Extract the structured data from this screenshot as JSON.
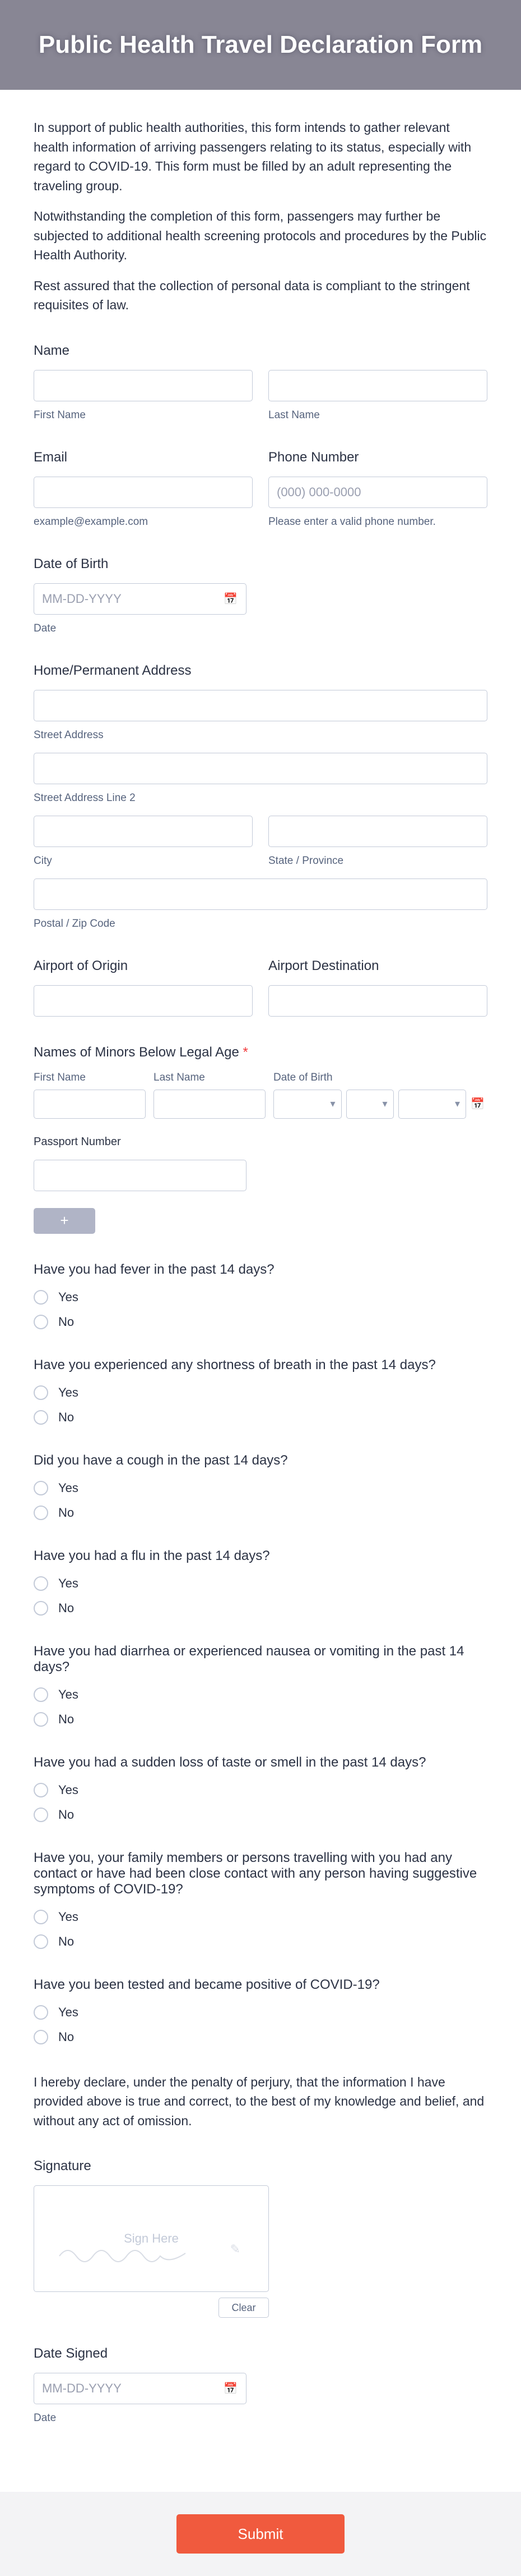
{
  "header": {
    "title": "Public Health Travel Declaration Form"
  },
  "intro": {
    "p1": "In support of public health authorities, this form intends to gather relevant health information of arriving passengers relating to its status, especially with regard to COVID-19. This form must be filled by an adult representing the traveling group.",
    "p2": "Notwithstanding the completion of this form, passengers may further be subjected to additional health screening protocols and procedures by the Public Health Authority.",
    "p3": "Rest assured that the collection of personal data is compliant to the stringent requisites of law."
  },
  "labels": {
    "name": "Name",
    "first_name_sub": "First Name",
    "last_name_sub": "Last Name",
    "email": "Email",
    "email_sub": "example@example.com",
    "phone": "Phone Number",
    "phone_placeholder": "(000) 000-0000",
    "phone_sub": "Please enter a valid phone number.",
    "dob": "Date of Birth",
    "date_placeholder": "MM-DD-YYYY",
    "date_sub": "Date",
    "address": "Home/Permanent Address",
    "street": "Street Address",
    "street2": "Street Address Line 2",
    "city": "City",
    "state": "State / Province",
    "postal": "Postal / Zip Code",
    "airport_origin": "Airport of Origin",
    "airport_dest": "Airport Destination",
    "minors": "Names of Minors Below Legal Age",
    "minors_fn": "First Name",
    "minors_ln": "Last Name",
    "minors_dob": "Date of Birth",
    "passport": "Passport Number",
    "add_plus": "+",
    "yes": "Yes",
    "no": "No",
    "signature": "Signature",
    "sign_here": "Sign Here",
    "clear": "Clear",
    "date_signed": "Date Signed",
    "submit": "Submit"
  },
  "questions": {
    "q1": "Have you had fever in the past 14 days?",
    "q2": "Have you experienced any shortness of breath in the past 14 days?",
    "q3": "Did you have a cough in the past 14 days?",
    "q4": "Have you had a flu in the past 14 days?",
    "q5": "Have you had diarrhea or experienced nausea or vomiting in the past 14 days?",
    "q6": "Have you had a sudden loss of taste or smell in the past 14 days?",
    "q7": "Have you, your family members or persons travelling with you had any contact or have had been close contact with any person having suggestive symptoms of COVID-19?",
    "q8": "Have you been tested and became positive of COVID-19?"
  },
  "declaration": "I hereby declare, under the penalty of perjury, that the information I have provided above is true and correct, to the best of my knowledge and belief, and without any act of omission."
}
